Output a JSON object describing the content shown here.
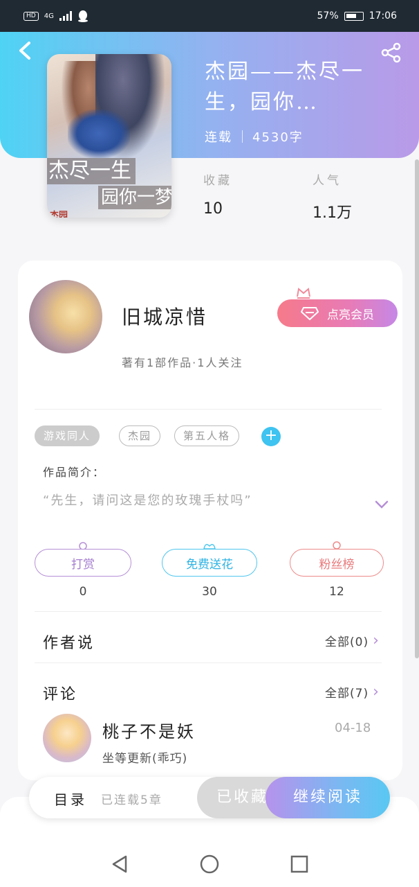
{
  "status_bar": {
    "hd": "HD",
    "network": "4G",
    "battery_percent": "57%",
    "time": "17:06"
  },
  "book": {
    "title": "杰园——杰尽一生，园你…",
    "status": "连载",
    "word_count": "4530字",
    "cover_title_line1": "杰尽一生",
    "cover_title_line2": "园你一梦",
    "cover_footer": "杰园"
  },
  "stats": {
    "favorites_label": "收藏",
    "favorites_value": "10",
    "popularity_label": "人气",
    "popularity_value": "1.1万"
  },
  "author": {
    "name": "旧城凉惜",
    "stats": "著有1部作品·1人关注",
    "vip_label": "点亮会员"
  },
  "tags": [
    "游戏同人",
    "杰园",
    "第五人格"
  ],
  "intro": {
    "label": "作品简介：",
    "text": "“先生，请问这是您的玫瑰手杖吗”"
  },
  "actions": {
    "reward_label": "打赏",
    "reward_count": "0",
    "flower_label": "免费送花",
    "flower_count": "30",
    "fans_label": "粉丝榜",
    "fans_count": "12"
  },
  "author_says": {
    "title": "作者说",
    "link": "全部(0)"
  },
  "comments": {
    "title": "评论",
    "link": "全部(7)",
    "items": [
      {
        "user": "桃子不是妖",
        "date": "04-18",
        "text": "坐等更新(乖巧)"
      }
    ]
  },
  "bottom_bar": {
    "catalog_label": "目录",
    "catalog_status": "已连载5章",
    "collected_label": "已收藏",
    "read_label": "继续阅读"
  },
  "colors": {
    "header_gradient_start": "#4fd3f4",
    "header_gradient_end": "#b99ae8",
    "vip_gradient_start": "#f67a8a",
    "reward_color": "#b58fd6",
    "flower_color": "#4fc6ee",
    "fans_color": "#ee8a8a"
  }
}
